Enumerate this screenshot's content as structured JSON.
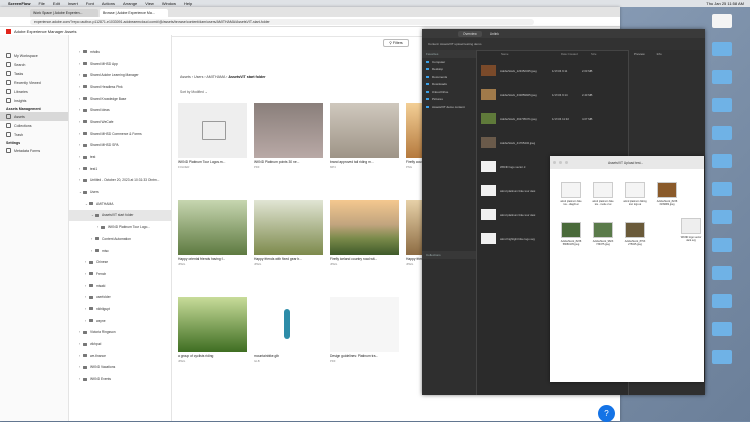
{
  "menubar": {
    "items": [
      "ScreenFlow",
      "File",
      "Edit",
      "Insert",
      "Font",
      "Actions",
      "Arrange",
      "View",
      "Window",
      "Help"
    ],
    "clock": "Thu Jan 25 11:58 AM"
  },
  "browser": {
    "tabs": [
      "Work Space | Adobe Experien...",
      "Browse | Adobe Experience Ma..."
    ],
    "url": "experience.adobe.com/?repo=author-p112871-e1033091.adobeaemcloud.com#/@/assets/browse/content/dam/users/AMITHAMA/AssetsVIT-start-folder",
    "aem_title": "Adobe Experience Manager Assets"
  },
  "leftnav": {
    "items": [
      {
        "label": "My Workspace",
        "icon": "home-icon"
      },
      {
        "label": "Search",
        "icon": "search-icon"
      },
      {
        "label": "Tasks",
        "icon": "tasks-icon"
      },
      {
        "label": "Recently Viewed",
        "icon": "clock-icon"
      },
      {
        "label": "Libraries",
        "icon": "library-icon"
      },
      {
        "label": "Insights",
        "icon": "insights-icon"
      }
    ],
    "section_assets": "Assets Management",
    "assets_items": [
      {
        "label": "Assets",
        "icon": "folder-icon",
        "selected": true
      },
      {
        "label": "Collections",
        "icon": "collections-icon"
      },
      {
        "label": "Trash",
        "icon": "trash-icon"
      }
    ],
    "section_settings": "Settings",
    "settings_items": [
      {
        "label": "Metadata Forms",
        "icon": "form-icon"
      }
    ]
  },
  "tree": {
    "nodes": [
      {
        "label": "mhdhu",
        "depth": 0,
        "chev": "›"
      },
      {
        "label": "Shared MHSD App",
        "depth": 0,
        "chev": "›"
      },
      {
        "label": "Shared Adobe Learning Manager",
        "depth": 0,
        "chev": "›"
      },
      {
        "label": "Shared Headless Pink",
        "depth": 0,
        "chev": "›"
      },
      {
        "label": "Shared Knowledge Base",
        "depth": 0,
        "chev": "›"
      },
      {
        "label": "Shared Ideas",
        "depth": 0,
        "chev": "›"
      },
      {
        "label": "Shared WeCafe",
        "depth": 0,
        "chev": "›"
      },
      {
        "label": "Shared MHSD Commerce & Forms",
        "depth": 0,
        "chev": "›"
      },
      {
        "label": "Shared MHSD SPA",
        "depth": 0,
        "chev": "›"
      },
      {
        "label": "test",
        "depth": 0,
        "chev": "›"
      },
      {
        "label": "test1",
        "depth": 0,
        "chev": "›"
      },
      {
        "label": "Untitled - October 20, 2023 at 10:31:33 Ointm...",
        "depth": 0,
        "chev": "›"
      },
      {
        "label": "Users",
        "depth": 0,
        "chev": "⌄"
      },
      {
        "label": "AMITHAMA",
        "depth": 1,
        "chev": "⌄"
      },
      {
        "label": "AssetsVIT start folder",
        "depth": 2,
        "chev": "⌄"
      },
      {
        "label": "WKND Platinum Tour Logo...",
        "depth": 3,
        "chev": "›"
      },
      {
        "label": "Content Automation",
        "depth": 2,
        "chev": "›"
      },
      {
        "label": "misc",
        "depth": 2,
        "chev": "›"
      },
      {
        "label": "Chinese",
        "depth": 1,
        "chev": "›"
      },
      {
        "label": "French",
        "depth": 1,
        "chev": "›"
      },
      {
        "label": "misaki",
        "depth": 1,
        "chev": "›"
      },
      {
        "label": "userfolder",
        "depth": 1,
        "chev": "›"
      },
      {
        "label": "nikhilgupt",
        "depth": 1,
        "chev": "›"
      },
      {
        "label": "wayne",
        "depth": 1,
        "chev": "›"
      },
      {
        "label": "Victoria Ringsson",
        "depth": 0,
        "chev": "›"
      },
      {
        "label": "vikhpud",
        "depth": 0,
        "chev": "›"
      },
      {
        "label": "we-finance",
        "depth": 0,
        "chev": "›"
      },
      {
        "label": "WKND Vacations",
        "depth": 0,
        "chev": "›"
      },
      {
        "label": "WKND Events",
        "depth": 0,
        "chev": "›"
      }
    ]
  },
  "main": {
    "filters_label": "Filters",
    "breadcrumb": [
      "Assets",
      "Users",
      "AMITHAMA"
    ],
    "folder_title": "AssetsVIT start folder",
    "sort_label": "Sort by",
    "sort_value": "Modified",
    "cards": [
      {
        "name": "WKND Platinum Tour Logos.m...",
        "ext": "FOLDER",
        "thumb": "folder"
      },
      {
        "name": "WKND Platinum points 30 ne...",
        "ext": "PDF",
        "thumb": "doc"
      },
      {
        "name": "brand approved tail riding m...",
        "ext": "MP4",
        "thumb": "sand"
      },
      {
        "name": "Firefly country",
        "ext": "PNG",
        "thumb": "sunset"
      },
      {
        "name": "Happy oriental friends having f...",
        "ext": "JPEG",
        "thumb": "bikes"
      },
      {
        "name": "Happy friends with fixed gear b...",
        "ext": "JPEG",
        "thumb": "bikes2"
      },
      {
        "name": "Firefly iceland country road wit...",
        "ext": "JPEG",
        "thumb": "road"
      },
      {
        "name": "Happy friends",
        "ext": "JPEG",
        "thumb": "bikes3"
      },
      {
        "name": "a group of cyclists riding",
        "ext": "JPEG",
        "thumb": "grass"
      },
      {
        "name": "mountainbike.glb",
        "ext": "GLB",
        "thumb": "bike"
      },
      {
        "name": "Design guidelines: Platinum tra...",
        "ext": "PDF",
        "thumb": "paper"
      }
    ]
  },
  "finder": {
    "top_tabs": [
      "Overview",
      "Unlink"
    ],
    "path_label": "Content: AssetsVIT upload testing demo",
    "sidebar_header_favorites": "Favorites",
    "sidebar_items": [
      "Computer",
      "Desktop",
      "Documents",
      "Downloads",
      "iCloud Drive",
      "Pictures",
      "AssetsVIT demo content"
    ],
    "collections_header": "Collections",
    "col_headers": [
      "Name",
      "Date Created",
      "Size"
    ],
    "rows": [
      {
        "name": "AdobeStock_123452345.jpeg",
        "date": "1/17/24 9:11",
        "size": "2.03 MB"
      },
      {
        "name": "AdobeStock_431859925.jpeg",
        "date": "1/17/24 9:14",
        "size": "2.43 MB"
      },
      {
        "name": "AdobeStock_461705471.jpeg",
        "date": "1/17/24 11:32",
        "size": "4.07 MB"
      },
      {
        "name": "AdobeStock_41765432.jpeg",
        "date": "",
        "size": ""
      },
      {
        "name": "WKND logo vector d",
        "date": "",
        "size": ""
      },
      {
        "name": "wknd platinum bike tour desi",
        "date": "",
        "size": ""
      },
      {
        "name": "wknd platinum bike tour desi",
        "date": "",
        "size": ""
      },
      {
        "name": "wknd highlight bike logo.svg",
        "date": "",
        "size": ""
      }
    ],
    "right_tabs": [
      "Preview",
      "Info"
    ]
  },
  "popup": {
    "title": "AssetsVIT Upload test...",
    "items": [
      {
        "name": "wknd platinum bike tou...diagrlt.ai"
      },
      {
        "name": "wknd platinum bike tou...mode 2.ai"
      },
      {
        "name": "wknd platinum biking tour logo.ai"
      },
      {
        "name": "AdobeStock_8238 3199982.jpeg"
      },
      {
        "name": "AdobeStock_8238 58080105.jpeg"
      },
      {
        "name": "AdobeStock_9823 739475.jpeg"
      },
      {
        "name": "AdobeStock_8793 275025.jpeg"
      },
      {
        "name": "WKND logo vector dark.svg"
      }
    ]
  }
}
